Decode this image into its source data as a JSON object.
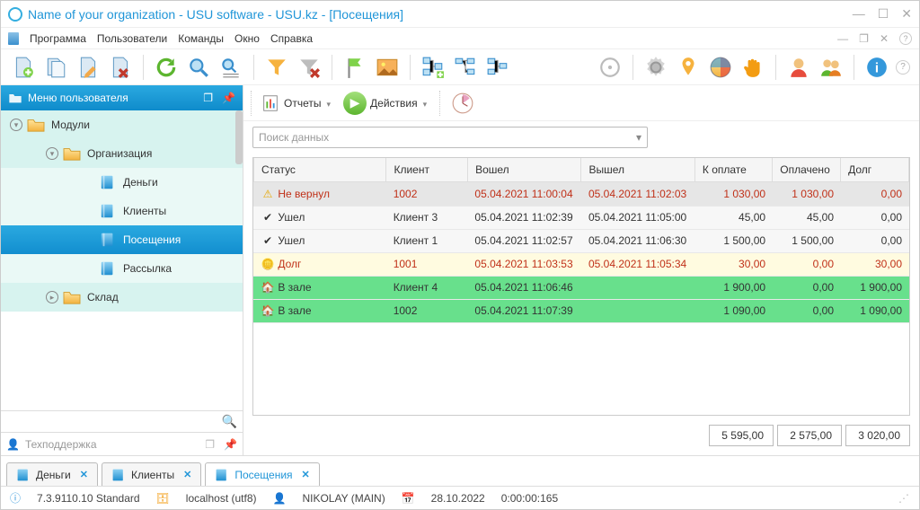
{
  "window": {
    "title": "Name of your organization - USU software - USU.kz - [Посещения]"
  },
  "menu": {
    "items": [
      "Программа",
      "Пользователи",
      "Команды",
      "Окно",
      "Справка"
    ]
  },
  "sidebar": {
    "header": "Меню пользователя",
    "nodes": {
      "modules": "Модули",
      "org": "Организация",
      "money": "Деньги",
      "clients": "Клиенты",
      "visits": "Посещения",
      "mailing": "Рассылка",
      "stock": "Склад"
    },
    "support": "Техподдержка"
  },
  "subtoolbar": {
    "reports": "Отчеты",
    "actions": "Действия"
  },
  "search": {
    "placeholder": "Поиск данных"
  },
  "grid": {
    "cols": [
      "Статус",
      "Клиент",
      "Вошел",
      "Вышел",
      "К оплате",
      "Оплачено",
      "Долг"
    ],
    "rows": [
      {
        "kind": "warn",
        "status": "Не вернул",
        "client": "1002",
        "in": "05.04.2021 11:00:04",
        "out": "05.04.2021 11:02:03",
        "pay": "1 030,00",
        "paid": "1 030,00",
        "debt": "0,00"
      },
      {
        "kind": "left",
        "status": "Ушел",
        "client": "Клиент 3",
        "in": "05.04.2021 11:02:39",
        "out": "05.04.2021 11:05:00",
        "pay": "45,00",
        "paid": "45,00",
        "debt": "0,00"
      },
      {
        "kind": "left",
        "status": "Ушел",
        "client": "Клиент 1",
        "in": "05.04.2021 11:02:57",
        "out": "05.04.2021 11:06:30",
        "pay": "1 500,00",
        "paid": "1 500,00",
        "debt": "0,00"
      },
      {
        "kind": "debt",
        "status": "Долг",
        "client": "1001",
        "in": "05.04.2021 11:03:53",
        "out": "05.04.2021 11:05:34",
        "pay": "30,00",
        "paid": "0,00",
        "debt": "30,00"
      },
      {
        "kind": "in",
        "status": "В зале",
        "client": "Клиент 4",
        "in": "05.04.2021 11:06:46",
        "out": "",
        "pay": "1 900,00",
        "paid": "0,00",
        "debt": "1 900,00"
      },
      {
        "kind": "in",
        "status": "В зале",
        "client": "1002",
        "in": "05.04.2021 11:07:39",
        "out": "",
        "pay": "1 090,00",
        "paid": "0,00",
        "debt": "1 090,00"
      }
    ],
    "totals": {
      "pay": "5 595,00",
      "paid": "2 575,00",
      "debt": "3 020,00"
    }
  },
  "tabs": [
    {
      "label": "Деньги"
    },
    {
      "label": "Клиенты"
    },
    {
      "label": "Посещения",
      "active": true
    }
  ],
  "status": {
    "version": "7.3.9110.10 Standard",
    "host": "localhost (utf8)",
    "user": "NIKOLAY (MAIN)",
    "date": "28.10.2022",
    "timer": "0:00:00:165"
  }
}
